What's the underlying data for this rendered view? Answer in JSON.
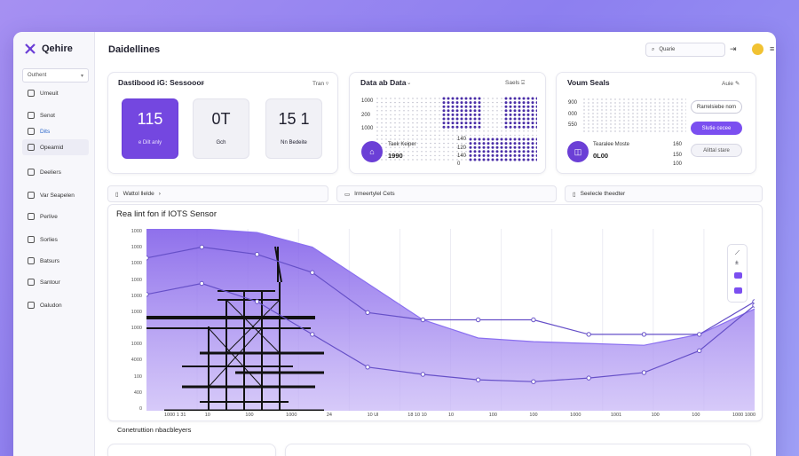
{
  "brand": {
    "name": "Qehire"
  },
  "sidebar": {
    "select_label": "Outhent",
    "items": [
      {
        "label": "Umeuit",
        "active": false
      },
      {
        "label": "Senot",
        "active": false
      },
      {
        "label": "Dits",
        "active": false,
        "highlight": true
      },
      {
        "label": "Opeamid",
        "active": true
      },
      {
        "label": "Deeliers",
        "active": false
      },
      {
        "label": "Var Seapelen",
        "active": false
      },
      {
        "label": "Perlive",
        "active": false
      },
      {
        "label": "Sorlies",
        "active": false
      },
      {
        "label": "Batsurs",
        "active": false
      },
      {
        "label": "Santour",
        "active": false
      },
      {
        "label": "Oaludon",
        "active": false
      }
    ]
  },
  "header": {
    "title": "Daidellines",
    "search_text": "Quarie"
  },
  "card_sensor": {
    "title": "Dastibood iG: Sessooor",
    "action": "Tran",
    "kpis": [
      {
        "value": "115",
        "label": "e Dilt anly",
        "primary": true
      },
      {
        "value": "0T",
        "label": "Gch",
        "primary": false
      },
      {
        "value": "15 1",
        "label": "Nn Bedeite",
        "primary": false
      }
    ]
  },
  "card_data": {
    "title": "Data ab Data",
    "action": "Saels",
    "axis_values": [
      "1000",
      "200",
      "1000"
    ],
    "metric_label": "Taek Keiper",
    "metric_value": "1990",
    "side_values": [
      "140",
      "120",
      "140",
      "0"
    ]
  },
  "card_seals": {
    "title": "Voum Seals",
    "action": "Auie",
    "axis_values": [
      "900",
      "000",
      "550"
    ],
    "metric_label": "Tearalee Moste",
    "metric_value": "0L00",
    "side_values": [
      "160",
      "150",
      "100"
    ],
    "buttons": [
      "Rarrelsiebe nom",
      "Slutie cecee",
      "Alittal stare"
    ]
  },
  "subtabs": [
    "Wattol llelde",
    "Irmeertylel Cets",
    "Seelecle theedter"
  ],
  "chart_data": {
    "type": "area",
    "title": "Rea lint fon if IOTS Sensor",
    "ytick_labels": [
      "1000",
      "1000",
      "1000",
      "1000",
      "1000",
      "1000",
      "1000",
      "1000",
      "4000",
      "100",
      "400",
      "0"
    ],
    "xtick_labels": [
      "1000 1 31",
      "10",
      "100",
      "1000",
      "24",
      "10 Ul",
      "18 10 10",
      "10",
      "100",
      "100",
      "1000",
      "1001",
      "100",
      "100",
      "1000 1000"
    ],
    "series": [
      {
        "name": "",
        "x": [
          0,
          1,
          2,
          3,
          4,
          5,
          6,
          7,
          8,
          9,
          10,
          11
        ],
        "y": [
          1000,
          1000,
          980,
          900,
          700,
          500,
          400,
          380,
          370,
          360,
          420,
          560
        ]
      },
      {
        "name": "",
        "x": [
          0,
          1,
          2,
          3,
          4,
          5,
          6,
          7,
          8,
          9,
          10,
          11
        ],
        "y": [
          840,
          900,
          860,
          760,
          540,
          500,
          500,
          500,
          420,
          420,
          420,
          600
        ]
      },
      {
        "name": "",
        "x": [
          0,
          1,
          2,
          3,
          4,
          5,
          6,
          7,
          8,
          9,
          10,
          11
        ],
        "y": [
          640,
          700,
          600,
          420,
          240,
          200,
          170,
          160,
          180,
          210,
          330,
          580
        ]
      }
    ],
    "grid": true,
    "background_image": "construction-site-tower-silhouette"
  },
  "bottom": {
    "title": "Conetruttion nbacbleyers"
  },
  "colors": {
    "accent": "#7447e0",
    "area_fill": "#9a80ef",
    "line": "#6650c8"
  }
}
